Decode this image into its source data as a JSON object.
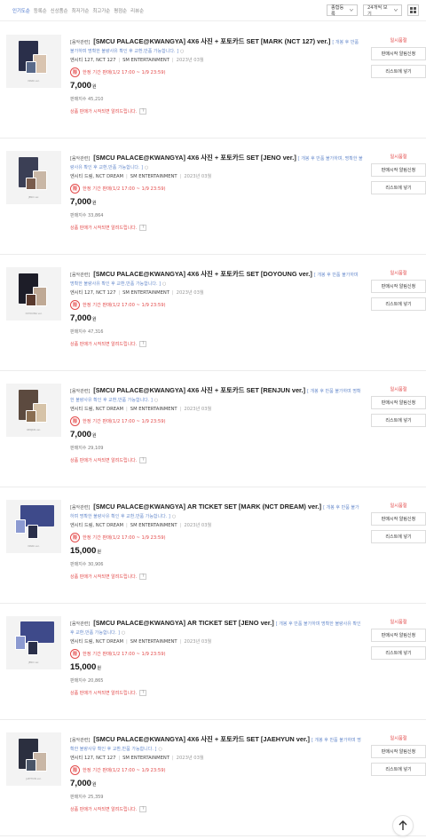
{
  "sort_tabs": [
    "인기도순",
    "등록순",
    "신상품순",
    "최저가순",
    "최고가순",
    "평점순",
    "리뷰순"
  ],
  "active_sort": 0,
  "filter": {
    "sort_select": "종합등록",
    "count_select": "24개씩 보기"
  },
  "common": {
    "limited_label": "한정 기간 판매(1/2 17:00 ~ 1/9 23:59)",
    "limited_icon_label": "限",
    "sale_notice": "상품 판매가 시작되면 알려드립니다.",
    "status": "일시품절",
    "alert_btn": "판매시작 알림신청",
    "wishlist_btn": "리스트에 넣기",
    "question_icon": "?"
  },
  "products": [
    {
      "tag": "[음악관련]",
      "title": "[SMCU PALACE@KWANGYA] 4X6 사진 + 포토카드 SET [MARK (NCT 127) ver.]",
      "note": "[ 개봉 후 반품 불가하며 명확한 불량사유 확인 후 교환,반품 가능합니다. ]",
      "artist": "엔시티 127, NCT 127",
      "company": "SM ENTERTAINMENT",
      "date": "2023년 03월",
      "price": "7,000",
      "won": "원",
      "sold": "판매지수 45,210",
      "thumb_caption": "MARK ver."
    },
    {
      "tag": "[음악관련]",
      "title": "[SMCU PALACE@KWANGYA] 4X6 사진 + 포토카드 SET [JENO ver.]",
      "note": "[ 개봉 후 반품 불가하며, 명확한 불량사유 확인 후 교환,반품 가능합니다. ]",
      "artist": "엔시티 드림, NCT DREAM",
      "company": "SM ENTERTAINMENT",
      "date": "2023년 03월",
      "price": "7,000",
      "won": "원",
      "sold": "판매지수 33,864",
      "thumb_caption": "JENO ver."
    },
    {
      "tag": "[음악관련]",
      "title": "[SMCU PALACE@KWANGYA] 4X6 사진 + 포토카드 SET [DOYOUNG ver.]",
      "note": "[ 개봉 후 반품 불가하며 명확한 불량사유 확인 후 교환,반품 가능합니다. ]",
      "artist": "엔시티 127, NCT 127",
      "company": "SM ENTERTAINMENT",
      "date": "2023년 03월",
      "price": "7,000",
      "won": "원",
      "sold": "판매지수 47,316",
      "thumb_caption": "DOYOUNG ver."
    },
    {
      "tag": "[음악관련]",
      "title": "[SMCU PALACE@KWANGYA] 4X6 사진 + 포토카드 SET [RENJUN ver.]",
      "note": "[ 개봉 후 반품 불가하며 명확한 불량사유 확인 후 교환,반품 가능합니다. ]",
      "artist": "엔시티 드림, NCT DREAM",
      "company": "SM ENTERTAINMENT",
      "date": "2023년 03월",
      "price": "7,000",
      "won": "원",
      "sold": "판매지수 29,109",
      "thumb_caption": "RENJUN ver."
    },
    {
      "tag": "[음악관련]",
      "title": "[SMCU PALACE@KWANGYA] AR TICKET SET [MARK (NCT DREAM) ver.]",
      "note": "[ 개봉 후 반품 불가하며 명확한 불량사유 확인 후 교환,반품 가능합니다. ]",
      "artist": "엔시티 드림, NCT DREAM",
      "company": "SM ENTERTAINMENT",
      "date": "2023년 03월",
      "price": "15,000",
      "won": "원",
      "sold": "판매지수 30,906",
      "thumb_caption": "MARK ver."
    },
    {
      "tag": "[음악관련]",
      "title": "[SMCU PALACE@KWANGYA] AR TICKET SET [JENO ver.]",
      "note": "[ 개봉 후 반품 불가하며 명확한 불량사유 확인 후 교환,반품 가능합니다. ]",
      "artist": "엔시티 드림, NCT DREAM",
      "company": "SM ENTERTAINMENT",
      "date": "2023년 03월",
      "price": "15,000",
      "won": "원",
      "sold": "판매지수 20,865",
      "thumb_caption": "JENO ver."
    },
    {
      "tag": "[음악관련]",
      "title": "[SMCU PALACE@KWANGYA] 4X6 사진 + 포토카드 SET [JAEHYUN ver.]",
      "note": "[ 개봉 후 반품 불가하며 명확한 불량사유 확인 후 교환,반품 가능합니다. ]",
      "artist": "엔시티 127, NCT 127",
      "company": "SM ENTERTAINMENT",
      "date": "2023년 03월",
      "price": "7,000",
      "won": "원",
      "sold": "판매지수 25,359",
      "thumb_caption": "JAEHYUN ver."
    }
  ],
  "colors": {
    "accent": "#3d6cc9",
    "alert": "#e34b4b"
  }
}
